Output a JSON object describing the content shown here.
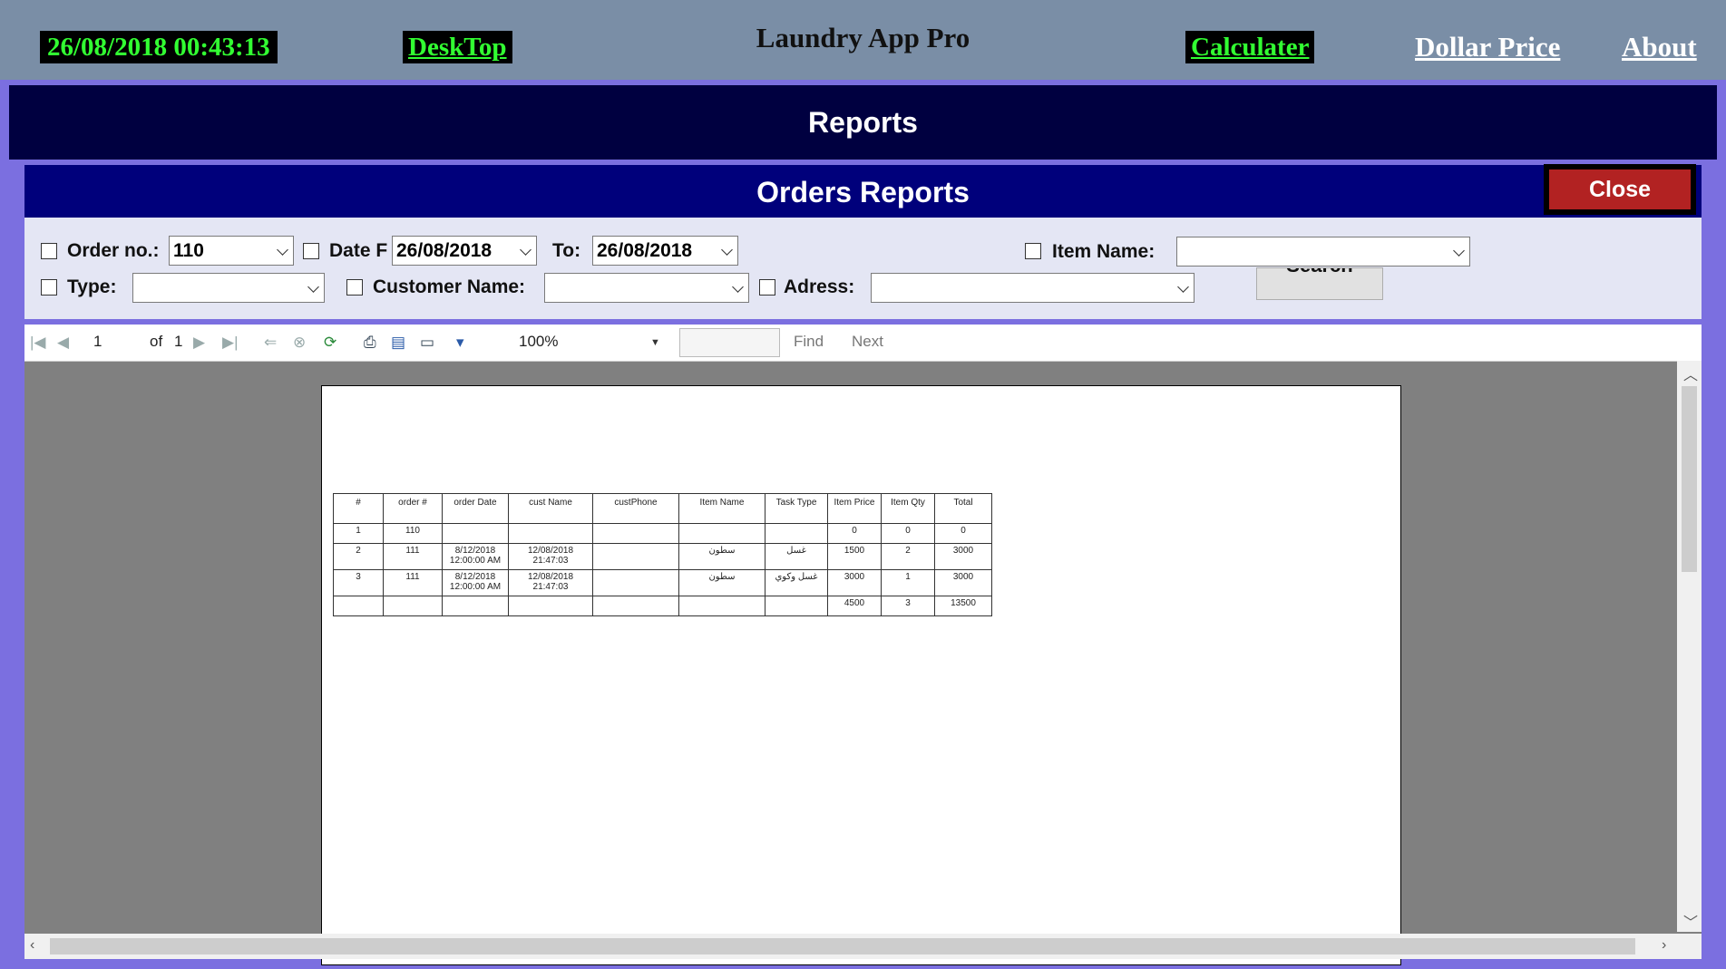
{
  "header": {
    "datetime": "26/08/2018 00:43:13",
    "desktop_link": "DeskTop",
    "app_title": "Laundry App Pro",
    "calculator_link": "Calculater",
    "dollar_price_link": "Dollar Price",
    "about_link": "About"
  },
  "page": {
    "title": "Reports",
    "subtitle": "Orders Reports",
    "close_label": "Close"
  },
  "filters": {
    "order_no_label": "Order no.:",
    "order_no_value": "110",
    "date_from_label": "Date F",
    "date_from_value": "26/08/2018",
    "to_label": "To:",
    "to_value": "26/08/2018",
    "item_name_label": "Item Name:",
    "item_name_value": "",
    "type_label": "Type:",
    "type_value": "",
    "customer_name_label": "Customer Name:",
    "customer_name_value": "",
    "address_label": "Adress:",
    "address_value": "",
    "search_label": "Search"
  },
  "toolbar": {
    "page_current": "1",
    "page_of": "of",
    "page_total": "1",
    "zoom": "100%",
    "find_label": "Find",
    "next_label": "Next"
  },
  "report": {
    "columns": [
      "#",
      "order #",
      "order Date",
      "cust Name",
      "custPhone",
      "Item Name",
      "Task Type",
      "Item Price",
      "Item Qty",
      "Total"
    ],
    "rows": [
      [
        "1",
        "110",
        "",
        "",
        "",
        "",
        "",
        "0",
        "0",
        "0"
      ],
      [
        "2",
        "111",
        "8/12/2018\n12:00:00 AM",
        "12/08/2018\n21:47:03",
        "",
        "سطون",
        "غسل",
        "1500",
        "2",
        "3000"
      ],
      [
        "3",
        "111",
        "8/12/2018\n12:00:00 AM",
        "12/08/2018\n21:47:03",
        "",
        "سطون",
        "غسل وكوي",
        "3000",
        "1",
        "3000"
      ]
    ],
    "totals": [
      "",
      "",
      "",
      "",
      "",
      "",
      "",
      "4500",
      "3",
      "13500"
    ]
  },
  "icons": {
    "first": "first-page-icon",
    "prev": "previous-page-icon",
    "next": "next-page-icon",
    "last": "last-page-icon",
    "back": "back-icon",
    "stop": "stop-icon",
    "refresh": "refresh-icon",
    "print": "print-icon",
    "layout": "print-layout-icon",
    "page_setup": "page-setup-icon",
    "export": "export-icon"
  }
}
